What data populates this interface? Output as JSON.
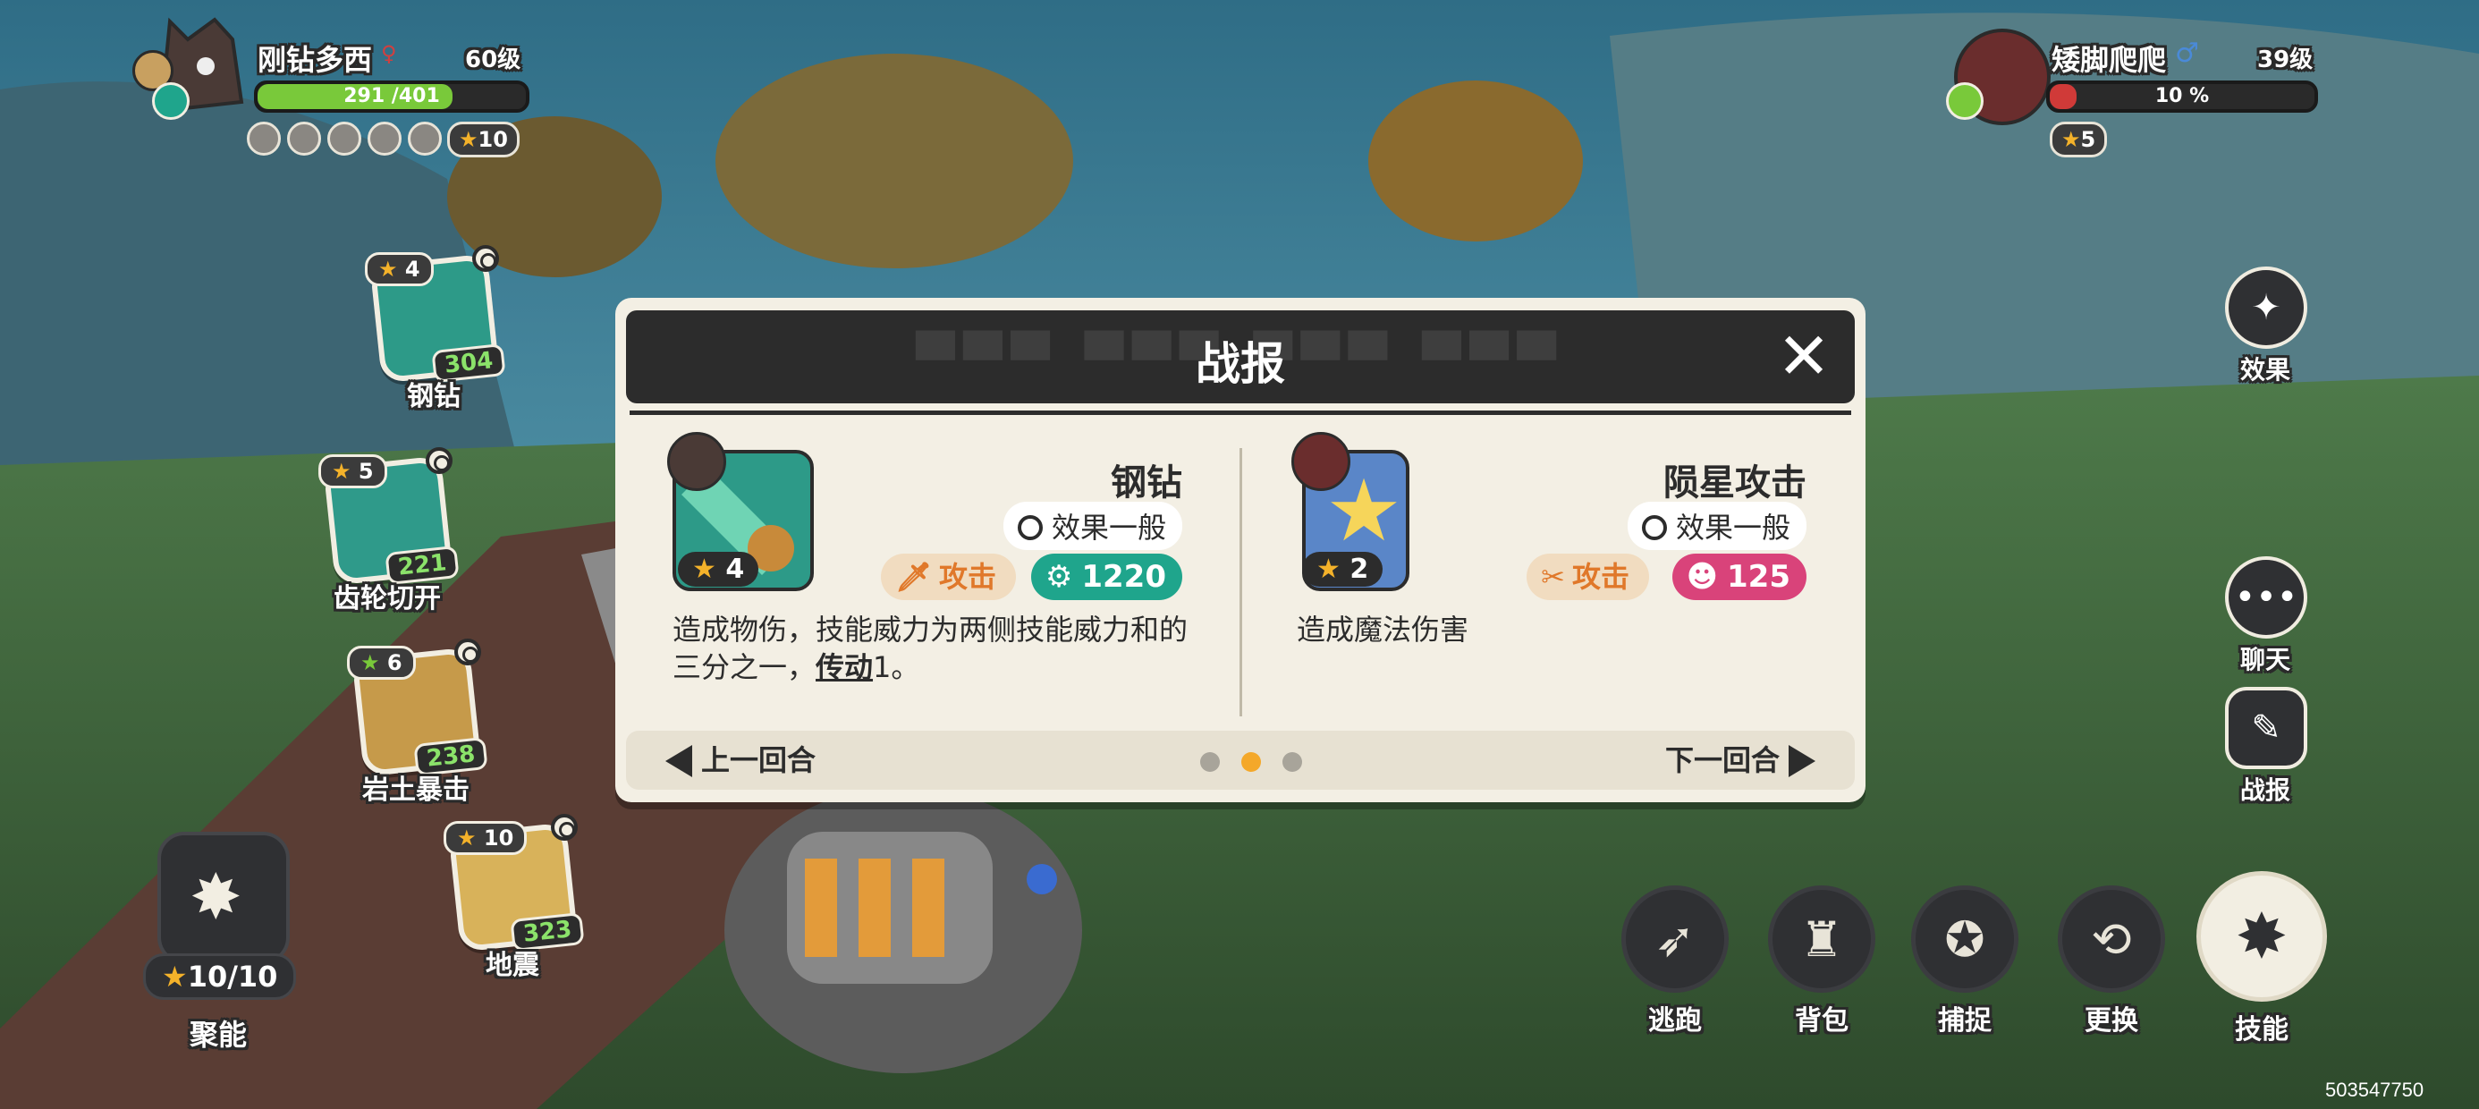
{
  "player": {
    "name": "刚钻多西",
    "level": "60级",
    "hp_text": "291 /401",
    "hp_fraction": 0.726,
    "star_count": "10"
  },
  "enemy": {
    "name": "矮脚爬爬",
    "level": "39级",
    "hp_text": "10 %",
    "hp_fraction": 0.1,
    "star_count": "5"
  },
  "skills": [
    {
      "level": "4",
      "power": "304",
      "name": "钢钻"
    },
    {
      "level": "5",
      "power": "221",
      "name": "齿轮切开"
    },
    {
      "level": "6",
      "power": "238",
      "name": "岩土暴击"
    },
    {
      "level": "10",
      "power": "323",
      "name": "地震"
    }
  ],
  "charge": {
    "value": "10/10",
    "label": "聚能"
  },
  "side_buttons": {
    "effect": "效果",
    "chat": "聊天",
    "report": "战报"
  },
  "bottom_buttons": {
    "escape": "逃跑",
    "bag": "背包",
    "capture": "捕捉",
    "swap": "更换",
    "skill": "技能"
  },
  "dialog": {
    "title": "战报",
    "left": {
      "skill_name": "钢钻",
      "effect": "效果一般",
      "level": "4",
      "type": "攻击",
      "power": "1220",
      "desc_part1": "造成物伤，技能威力为两侧技能威力和的三分之一，",
      "desc_link": "传动",
      "desc_part2": "1。"
    },
    "right": {
      "skill_name": "陨星攻击",
      "effect": "效果一般",
      "level": "2",
      "type": "攻击",
      "power": "125",
      "desc": "造成魔法伤害"
    },
    "prev": "上一回合",
    "next": "下一回合",
    "page_count": 3,
    "current_page": 2
  },
  "uid": "503547750",
  "colors": {
    "hp_green": "#79c93a",
    "enemy_red": "#d03a38",
    "gear_teal": "#1fa58c",
    "magic_pink": "#d9437a",
    "attack_orange": "#e0782a",
    "active_dot": "#f4a82a"
  }
}
